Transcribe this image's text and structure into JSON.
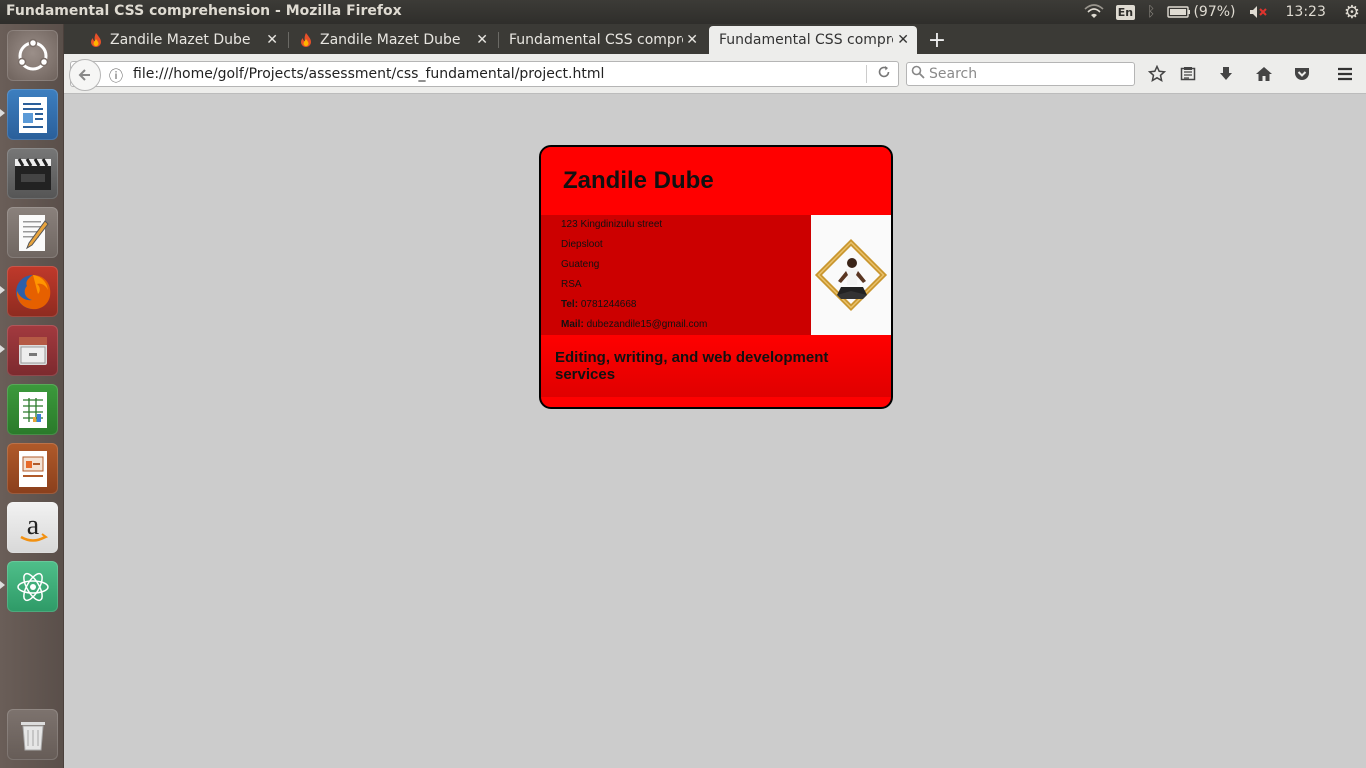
{
  "window": {
    "title": "Fundamental CSS comprehension - Mozilla Firefox",
    "keyboard": "En",
    "battery": "(97%)",
    "clock": "13:23"
  },
  "tabs": [
    {
      "label": "Zandile Mazet Dube",
      "active": false
    },
    {
      "label": "Zandile Mazet Dube",
      "active": false
    },
    {
      "label": "Fundamental CSS compre",
      "active": false
    },
    {
      "label": "Fundamental CSS compre",
      "active": true
    }
  ],
  "navbar": {
    "url": "file:///home/golf/Projects/assessment/css_fundamental/project.html",
    "search_placeholder": "Search"
  },
  "card": {
    "name": "Zandile Dube",
    "address": [
      "123 Kingdinizulu street",
      "Diepsloot",
      "Guateng",
      "RSA"
    ],
    "tel_label": "Tel:",
    "tel_value": "0781244668",
    "mail_label": "Mail:",
    "mail_value": "dubezandile15@gmail.com",
    "tagline": "Editing, writing, and web development services"
  },
  "colors": {
    "card_bg": "#ff0000",
    "card_info_bg": "#cc0000",
    "page_bg": "#cccccc"
  }
}
